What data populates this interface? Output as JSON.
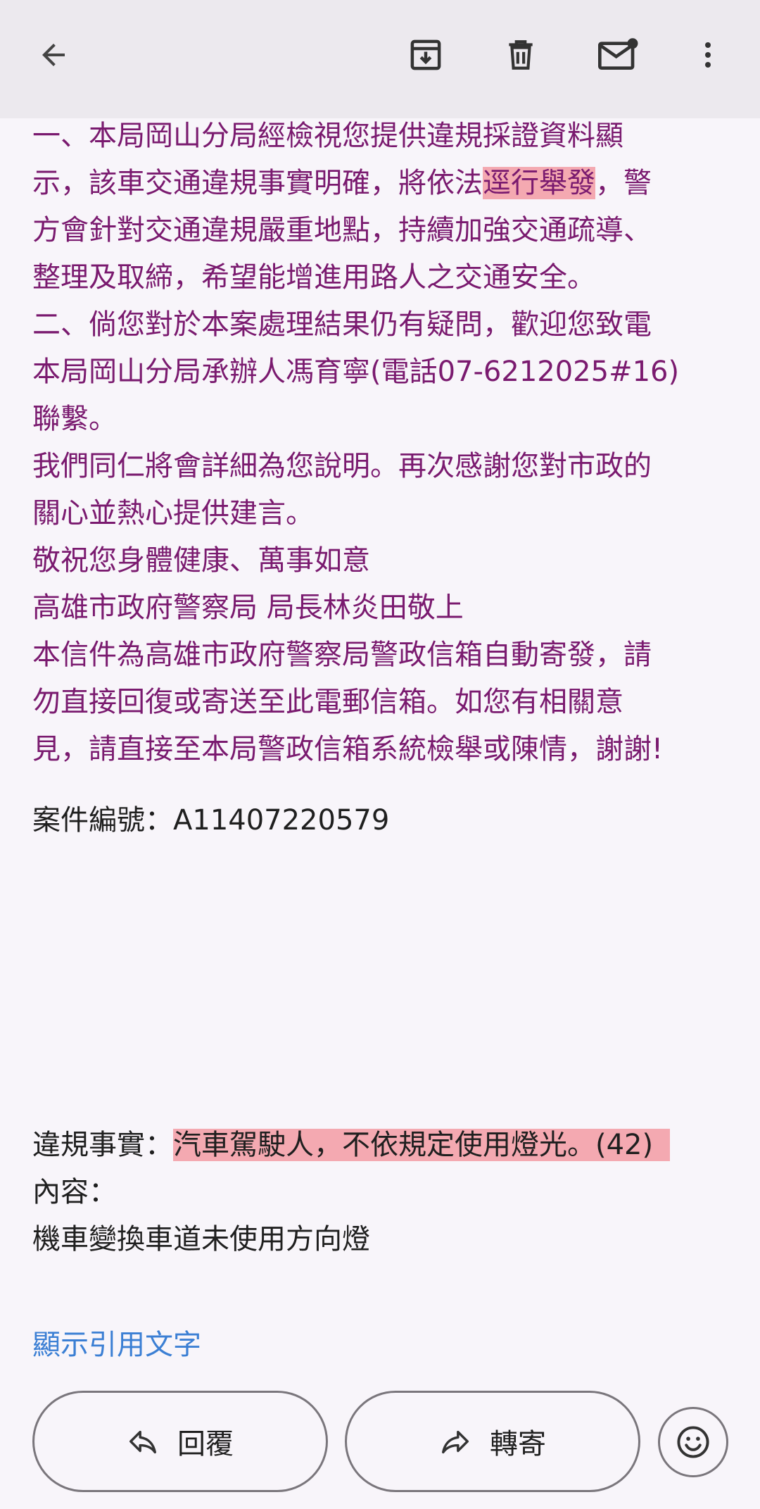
{
  "toolbar": {
    "back_icon": "arrow-back-icon",
    "archive_icon": "archive-icon",
    "delete_icon": "trash-icon",
    "mark_unread_icon": "mark-unread-icon",
    "more_icon": "more-vert-icon"
  },
  "body": {
    "p1": {
      "line1": "一、本局岡山分局經檢視您提供違規採證資料顯",
      "line2a": "示，該車交通違規事實明確，將依法",
      "line2b": "逕行舉發",
      "line2c": "，警",
      "line3": "方會針對交通違規嚴重地點，持續加強交通疏導、",
      "line4": "整理及取締，希望能增進用路人之交通安全。"
    },
    "p2": {
      "line1": "二、倘您對於本案處理結果仍有疑問，歡迎您致電",
      "line2": "本局岡山分局承辦人馮育寧(電話07-6212025#16)",
      "line3": "聯繫。"
    },
    "p3": {
      "line1": "我們同仁將會詳細為您說明。再次感謝您對市政的",
      "line2": "關心並熱心提供建言。"
    },
    "closing": "敬祝您身體健康、萬事如意",
    "signature": "高雄市政府警察局 局長林炎田敬上",
    "notice": {
      "line1": "本信件為高雄市政府警察局警政信箱自動寄發，請",
      "line2": "勿直接回復或寄送至此電郵信箱。如您有相關意",
      "line3": "見，請直接至本局警政信箱系統檢舉或陳情，謝謝!"
    },
    "case_label": "案件編號：",
    "case_number": "A11407220579",
    "violation_label": "違規事實：",
    "violation_value": "汽車駕駛人，不依規定使用燈光。(42)",
    "content_label": "內容：",
    "content_value": "機車變換車道未使用方向燈"
  },
  "show_quoted": "顯示引用文字",
  "actions": {
    "reply_label": "回覆",
    "forward_label": "轉寄",
    "reply_icon": "reply-icon",
    "forward_icon": "forward-icon",
    "emoji_icon": "emoji-icon"
  },
  "colors": {
    "body_text": "#7a1a6f",
    "highlight": "#f4a9b1",
    "link": "#3b7fd4",
    "appbar": "#ece9ee"
  }
}
